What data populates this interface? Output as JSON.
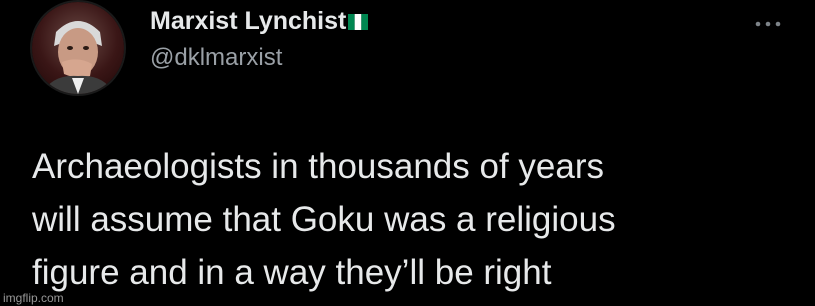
{
  "tweet": {
    "author": {
      "display_name": "Marxist Lynchist",
      "flag": "nigeria-flag",
      "handle": "@dklmarxist"
    },
    "more_icon": "more-options-icon",
    "text_lines": [
      "Archaeologists in thousands of years",
      "will assume that Goku was a religious",
      "figure and in a way they’ll be right"
    ]
  },
  "watermark": "imgflip.com",
  "colors": {
    "background": "#000000",
    "text_primary": "#e7e9ea",
    "text_secondary": "#9aa0a6",
    "flag_green": "#008751",
    "flag_white": "#ffffff"
  }
}
